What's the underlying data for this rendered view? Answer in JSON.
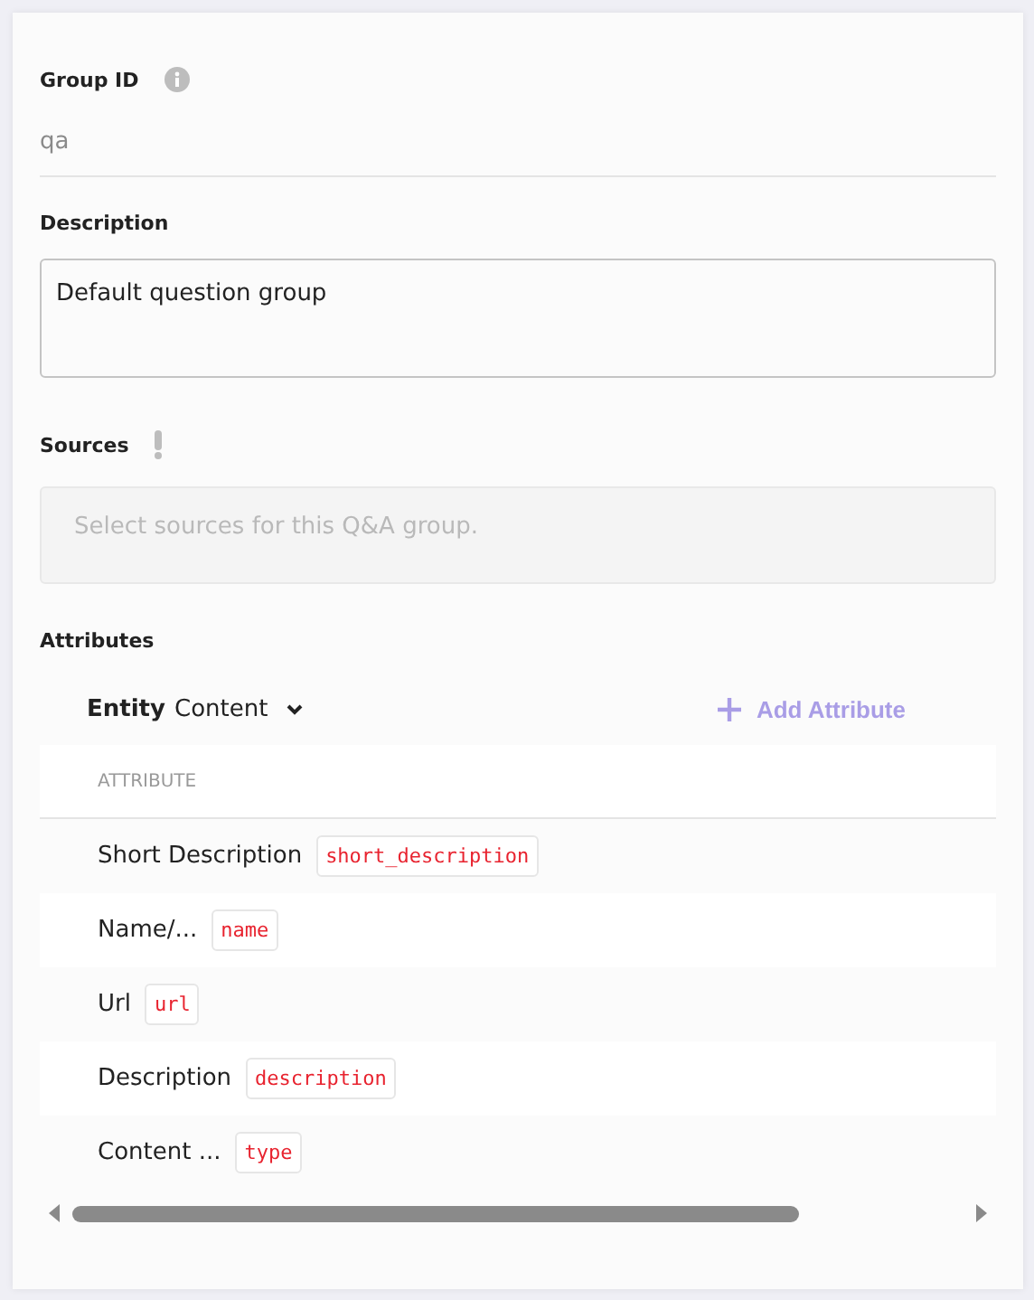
{
  "group_id": {
    "label": "Group ID",
    "value": "qa"
  },
  "description": {
    "label": "Description",
    "value": "Default question group"
  },
  "sources": {
    "label": "Sources",
    "placeholder": "Select sources for this Q&A group."
  },
  "attributes": {
    "label": "Attributes",
    "entity": {
      "label": "Entity",
      "value": "Content"
    },
    "add_button": "Add Attribute",
    "column": "ATTRIBUTE",
    "rows": [
      {
        "name": "Short Description",
        "key": "short_description"
      },
      {
        "name": "Name/...",
        "key": "name"
      },
      {
        "name": "Url",
        "key": "url"
      },
      {
        "name": "Description",
        "key": "description"
      },
      {
        "name": "Content ...",
        "key": "type"
      }
    ]
  }
}
